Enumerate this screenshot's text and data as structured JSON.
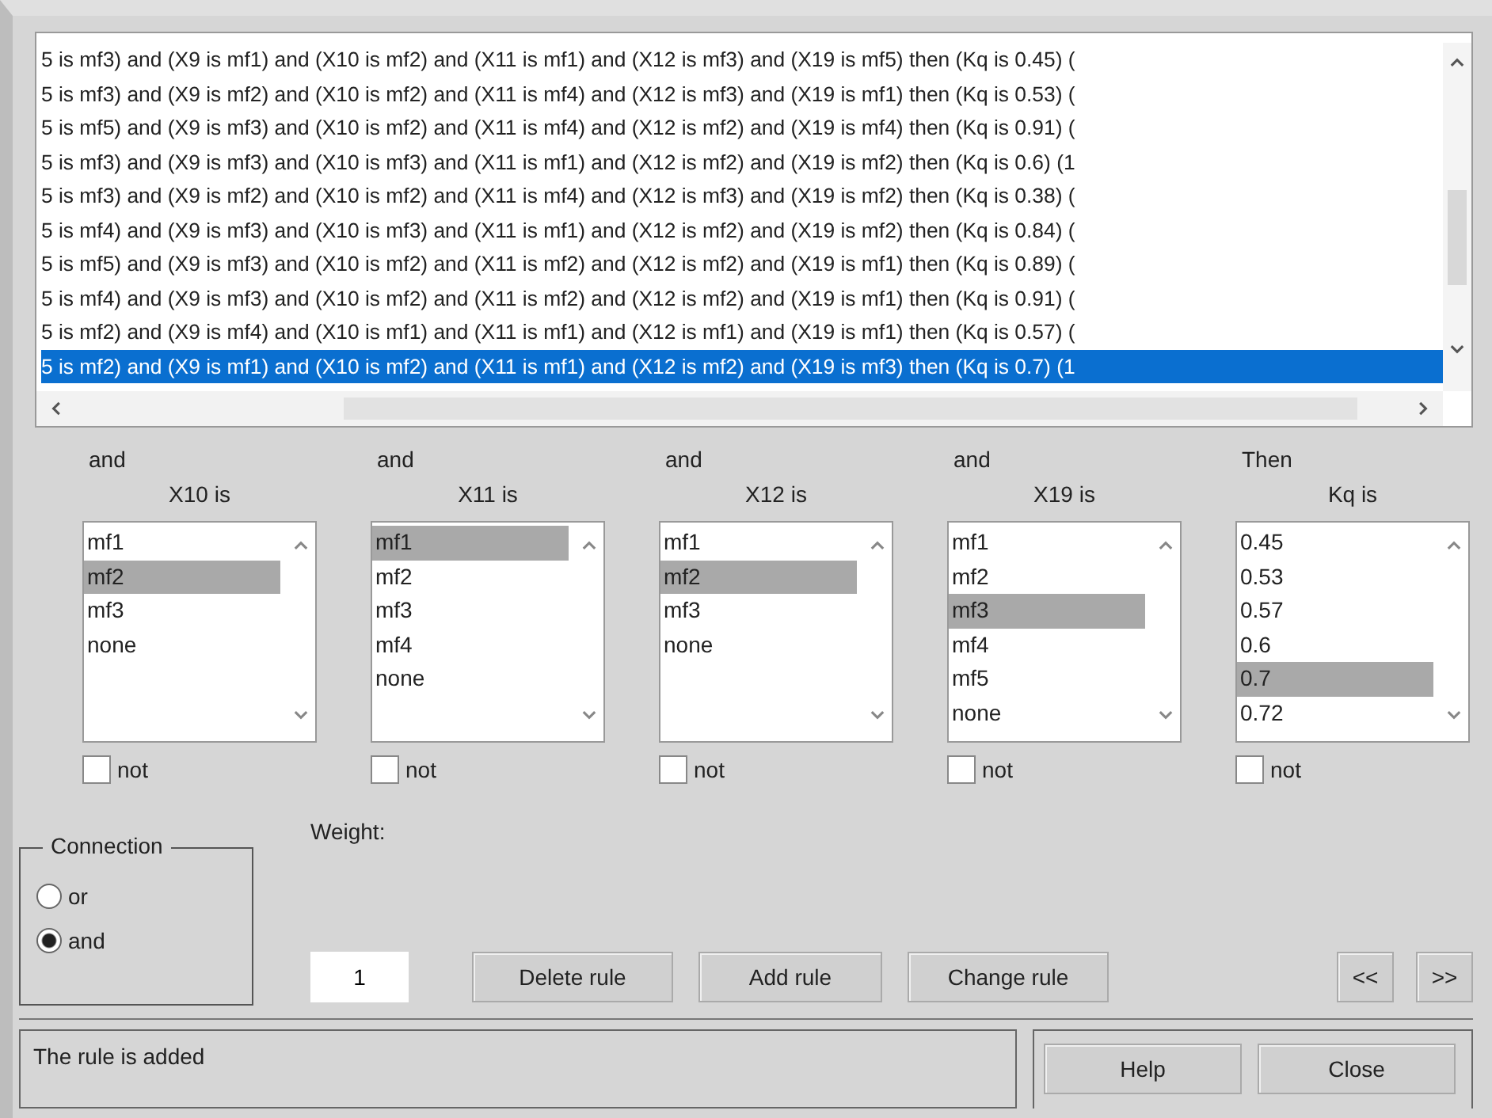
{
  "rules": [
    {
      "text": "5 is mf3) and (X9 is mf1) and (X10 is mf2) and (X11 is mf1) and (X12 is mf3) and (X19 is mf5) then (Kq is 0.45) (",
      "selected": false
    },
    {
      "text": "5 is mf3) and (X9 is mf2) and (X10 is mf2) and (X11 is mf4) and (X12 is mf3) and (X19 is mf1) then (Kq is 0.53) (",
      "selected": false
    },
    {
      "text": "5 is mf5) and (X9 is mf3) and (X10 is mf2) and (X11 is mf4) and (X12 is mf2) and (X19 is mf4) then (Kq is 0.91) (",
      "selected": false
    },
    {
      "text": "5 is mf3) and (X9 is mf3) and (X10 is mf3) and (X11 is mf1) and (X12 is mf2) and (X19 is mf2) then (Kq is 0.6) (1",
      "selected": false
    },
    {
      "text": "5 is mf3) and (X9 is mf2) and (X10 is mf2) and (X11 is mf4) and (X12 is mf3) and (X19 is mf2) then (Kq is 0.38) (",
      "selected": false
    },
    {
      "text": "5 is mf4) and (X9 is mf3) and (X10 is mf3) and (X11 is mf1) and (X12 is mf2) and (X19 is mf2) then (Kq is 0.84) (",
      "selected": false
    },
    {
      "text": "5 is mf5) and (X9 is mf3) and (X10 is mf2) and (X11 is mf2) and (X12 is mf2) and (X19 is mf1) then (Kq is 0.89) (",
      "selected": false
    },
    {
      "text": "5 is mf4) and (X9 is mf3) and (X10 is mf2) and (X11 is mf2) and (X12 is mf2) and (X19 is mf1) then (Kq is 0.91) (",
      "selected": false
    },
    {
      "text": "5 is mf2) and (X9 is mf4) and (X10 is mf1) and (X11 is mf1) and (X12 is mf1) and (X19 is mf1) then (Kq is 0.57) (",
      "selected": false
    },
    {
      "text": "5 is mf2) and (X9 is mf1) and (X10 is mf2) and (X11 is mf1) and (X12 is mf2) and (X19 is mf3) then (Kq is 0.7) (1",
      "selected": true
    }
  ],
  "variables": [
    {
      "connector": "and",
      "label": "X10 is",
      "not_checked": false,
      "options": [
        {
          "text": "mf1",
          "selected": false
        },
        {
          "text": "mf2",
          "selected": true
        },
        {
          "text": "mf3",
          "selected": false
        },
        {
          "text": "none",
          "selected": false
        }
      ],
      "not_label": "not"
    },
    {
      "connector": "and",
      "label": "X11 is",
      "not_checked": false,
      "options": [
        {
          "text": "mf1",
          "selected": true
        },
        {
          "text": "mf2",
          "selected": false
        },
        {
          "text": "mf3",
          "selected": false
        },
        {
          "text": "mf4",
          "selected": false
        },
        {
          "text": "none",
          "selected": false
        }
      ],
      "not_label": "not"
    },
    {
      "connector": "and",
      "label": "X12 is",
      "not_checked": false,
      "options": [
        {
          "text": "mf1",
          "selected": false
        },
        {
          "text": "mf2",
          "selected": true
        },
        {
          "text": "mf3",
          "selected": false
        },
        {
          "text": "none",
          "selected": false
        }
      ],
      "not_label": "not"
    },
    {
      "connector": "and",
      "label": "X19 is",
      "not_checked": false,
      "options": [
        {
          "text": "mf1",
          "selected": false
        },
        {
          "text": "mf2",
          "selected": false
        },
        {
          "text": "mf3",
          "selected": true
        },
        {
          "text": "mf4",
          "selected": false
        },
        {
          "text": "mf5",
          "selected": false
        },
        {
          "text": "none",
          "selected": false
        }
      ],
      "not_label": "not"
    },
    {
      "connector": "Then",
      "label": "Kq is",
      "not_checked": false,
      "options": [
        {
          "text": "0.45",
          "selected": false
        },
        {
          "text": "0.53",
          "selected": false
        },
        {
          "text": "0.57",
          "selected": false
        },
        {
          "text": "0.6",
          "selected": false
        },
        {
          "text": "0.7",
          "selected": true
        },
        {
          "text": "0.72",
          "selected": false
        }
      ],
      "not_label": "not"
    }
  ],
  "connection": {
    "title": "Connection",
    "options": [
      {
        "label": "or",
        "selected": false
      },
      {
        "label": "and",
        "selected": true
      }
    ]
  },
  "weight": {
    "label": "Weight:",
    "value": "1"
  },
  "buttons": [
    "Delete rule",
    "Add rule",
    "Change rule"
  ],
  "nav_buttons": [
    "<<",
    ">>"
  ],
  "status": "The rule is added",
  "footer_buttons": [
    "Help",
    "Close"
  ]
}
